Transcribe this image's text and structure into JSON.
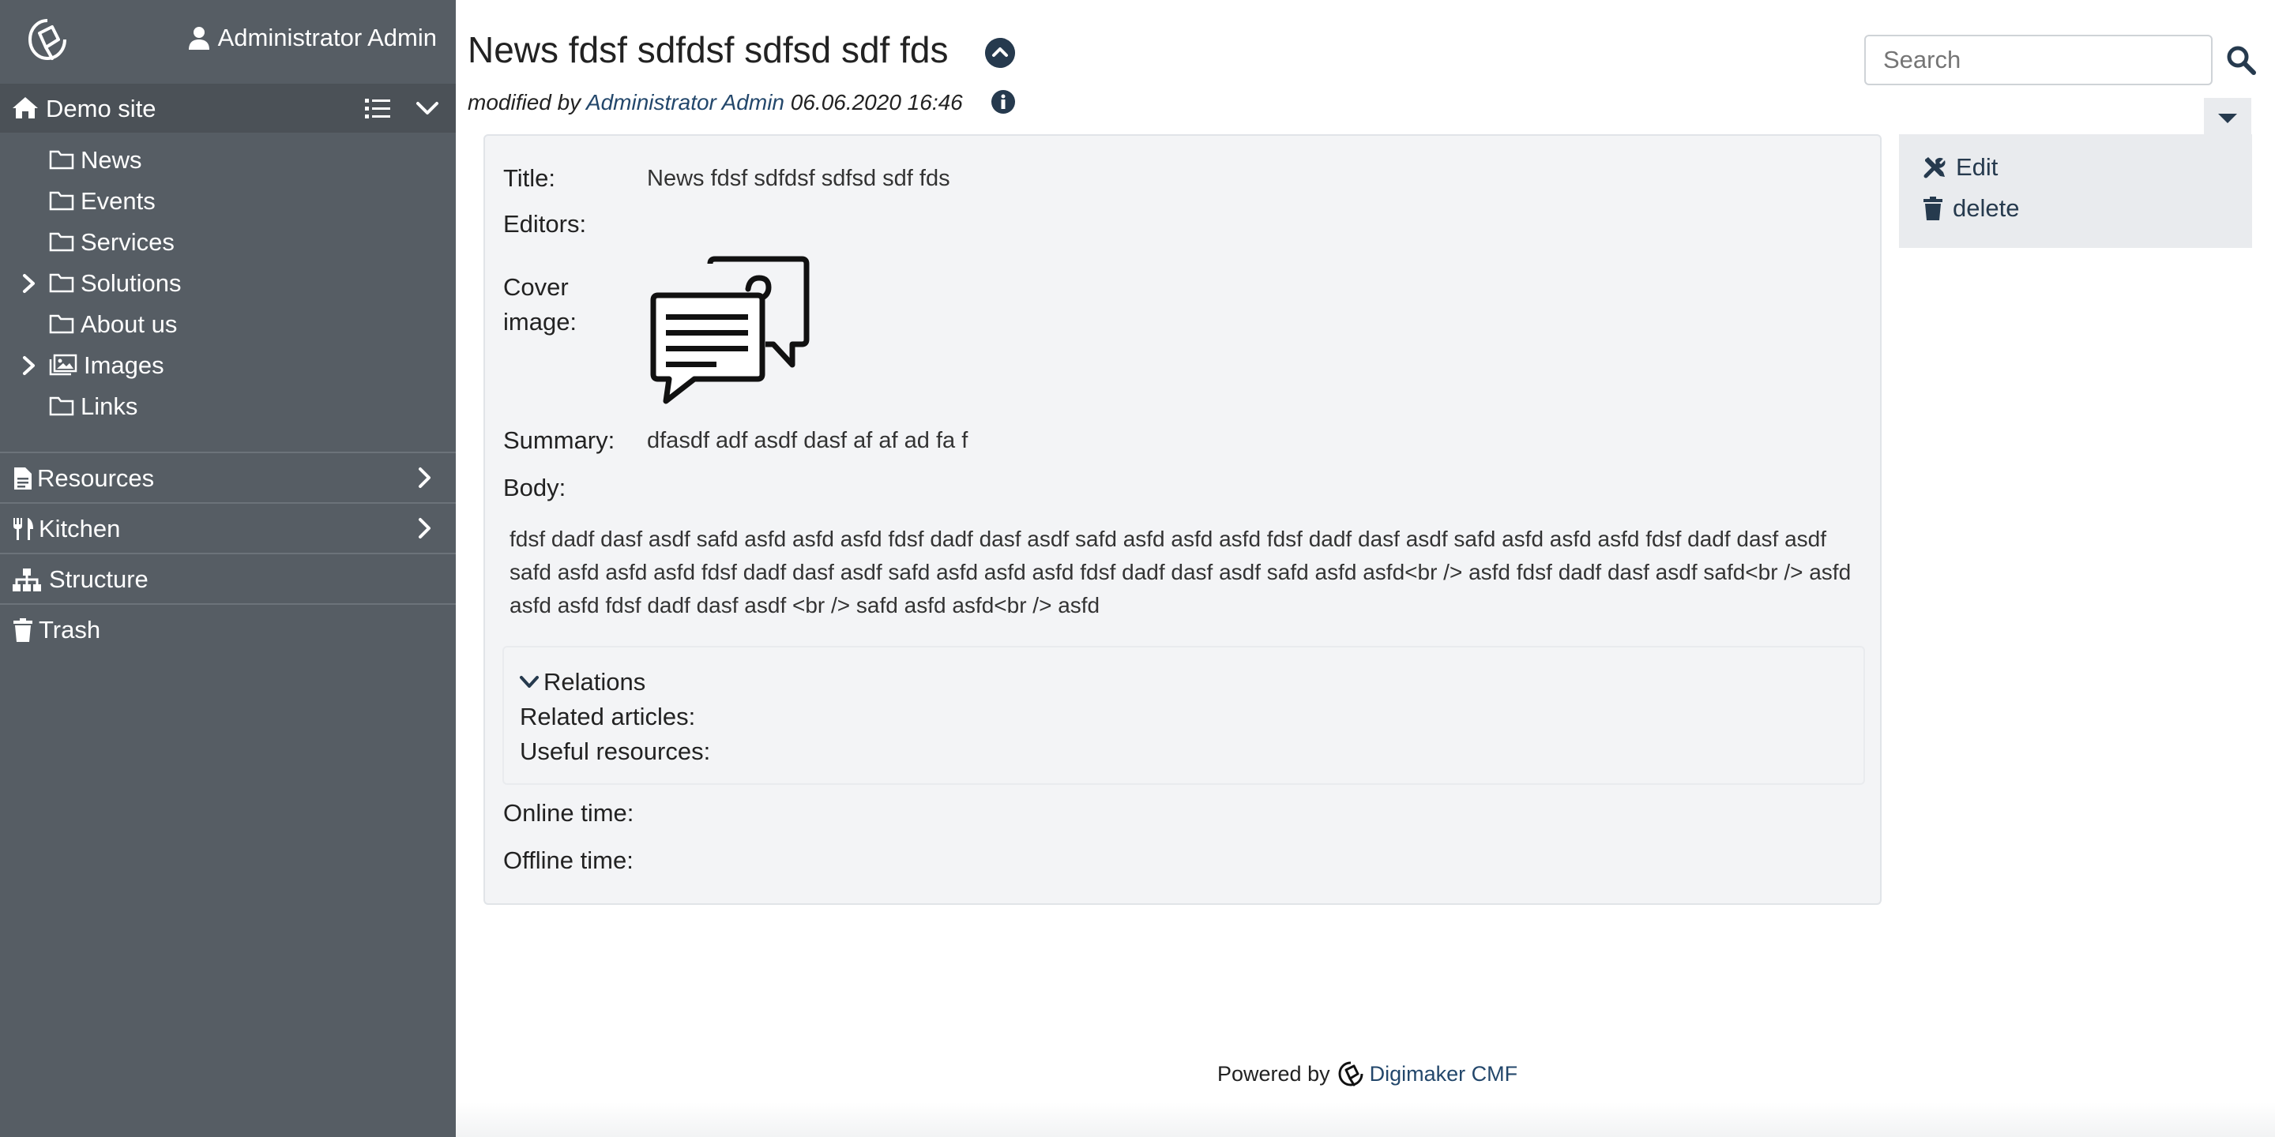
{
  "sidebar": {
    "user_name": "Administrator Admin",
    "site_label": "Demo site",
    "tree": [
      {
        "label": "News",
        "expandable": false
      },
      {
        "label": "Events",
        "expandable": false
      },
      {
        "label": "Services",
        "expandable": false
      },
      {
        "label": "Solutions",
        "expandable": true
      },
      {
        "label": "About us",
        "expandable": false
      },
      {
        "label": "Images",
        "expandable": true
      },
      {
        "label": "Links",
        "expandable": false
      }
    ],
    "sections": [
      {
        "label": "Resources"
      },
      {
        "label": "Kitchen"
      },
      {
        "label": "Structure"
      },
      {
        "label": "Trash"
      }
    ]
  },
  "header": {
    "title": "News fdsf sdfdsf sdfsd sdf fds",
    "modified_prefix": "modified by",
    "modified_by": "Administrator Admin",
    "modified_at": "06.06.2020 16:46",
    "search_placeholder": "Search"
  },
  "content": {
    "title_label": "Title:",
    "title_value": "News fdsf sdfdsf sdfsd sdf fds",
    "editors_label": "Editors:",
    "cover_label_1": "Cover",
    "cover_label_2": "image:",
    "summary_label": "Summary:",
    "summary_value": "dfasdf adf asdf dasf af af ad fa f",
    "body_label": "Body:",
    "body_value": "fdsf dadf dasf asdf safd asfd asfd asfd fdsf dadf dasf asdf safd asfd asfd asfd fdsf dadf dasf asdf safd asfd asfd asfd fdsf dadf dasf asdf safd asfd asfd asfd fdsf dadf dasf asdf safd asfd asfd asfd fdsf dadf dasf asdf safd asfd asfd<br /> asfd fdsf dadf dasf asdf safd<br /> asfd asfd asfd fdsf dadf dasf asdf <br /> safd asfd asfd<br /> asfd",
    "relations_label": "Relations",
    "related_articles_label": "Related articles:",
    "useful_resources_label": "Useful resources:",
    "online_time_label": "Online time:",
    "offline_time_label": "Offline time:"
  },
  "actions": {
    "edit_label": "Edit",
    "delete_label": "delete"
  },
  "footer": {
    "powered_by": "Powered by",
    "brand": "Digimaker CMF"
  },
  "colors": {
    "sidebar_bg": "#565d64",
    "accent_navy": "#263a4e",
    "content_bg": "#f3f4f6"
  }
}
